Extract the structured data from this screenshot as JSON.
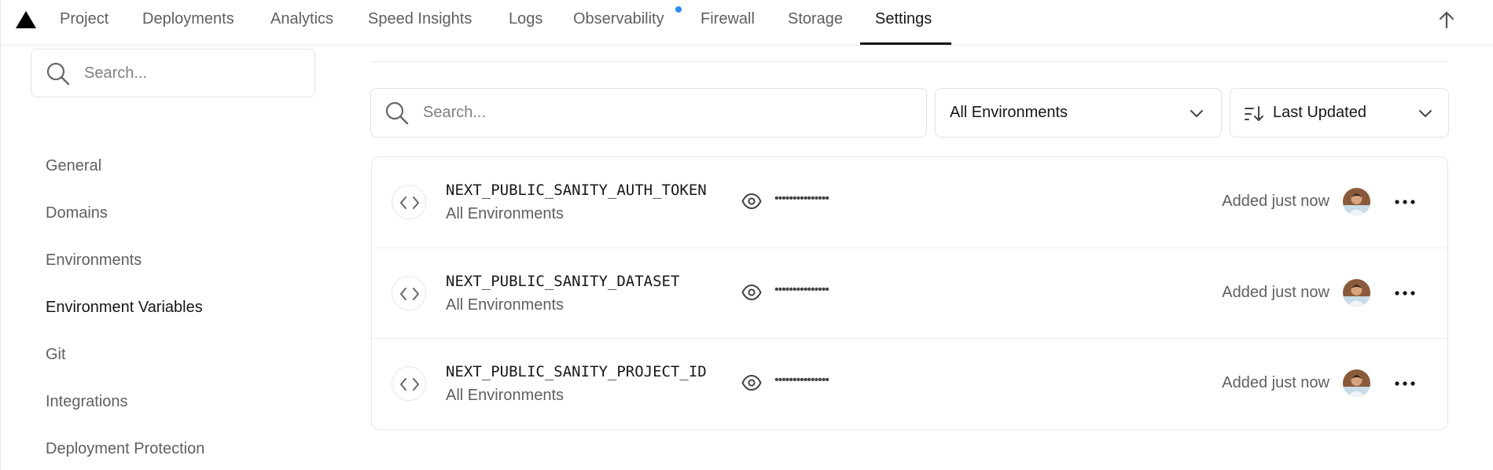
{
  "topnav": {
    "tabs": [
      {
        "label": "Project"
      },
      {
        "label": "Deployments"
      },
      {
        "label": "Analytics"
      },
      {
        "label": "Speed Insights"
      },
      {
        "label": "Logs"
      },
      {
        "label": "Observability"
      },
      {
        "label": "Firewall"
      },
      {
        "label": "Storage"
      },
      {
        "label": "Settings",
        "active": true
      }
    ],
    "accent_dot_color": "#2b8bf5"
  },
  "sidebar": {
    "search_placeholder": "Search...",
    "items": [
      {
        "label": "General"
      },
      {
        "label": "Domains"
      },
      {
        "label": "Environments"
      },
      {
        "label": "Environment Variables",
        "active": true
      },
      {
        "label": "Git"
      },
      {
        "label": "Integrations"
      },
      {
        "label": "Deployment Protection"
      }
    ]
  },
  "filters": {
    "search_placeholder": "Search...",
    "environment_select": "All Environments",
    "sort_select": "Last Updated"
  },
  "env_vars": [
    {
      "name": "NEXT_PUBLIC_SANITY_AUTH_TOKEN",
      "environment": "All Environments",
      "masked_value": "•••••••••••••••",
      "updated": "Added just now"
    },
    {
      "name": "NEXT_PUBLIC_SANITY_DATASET",
      "environment": "All Environments",
      "masked_value": "•••••••••••••••",
      "updated": "Added just now"
    },
    {
      "name": "NEXT_PUBLIC_SANITY_PROJECT_ID",
      "environment": "All Environments",
      "masked_value": "•••••••••••••••",
      "updated": "Added just now"
    }
  ]
}
